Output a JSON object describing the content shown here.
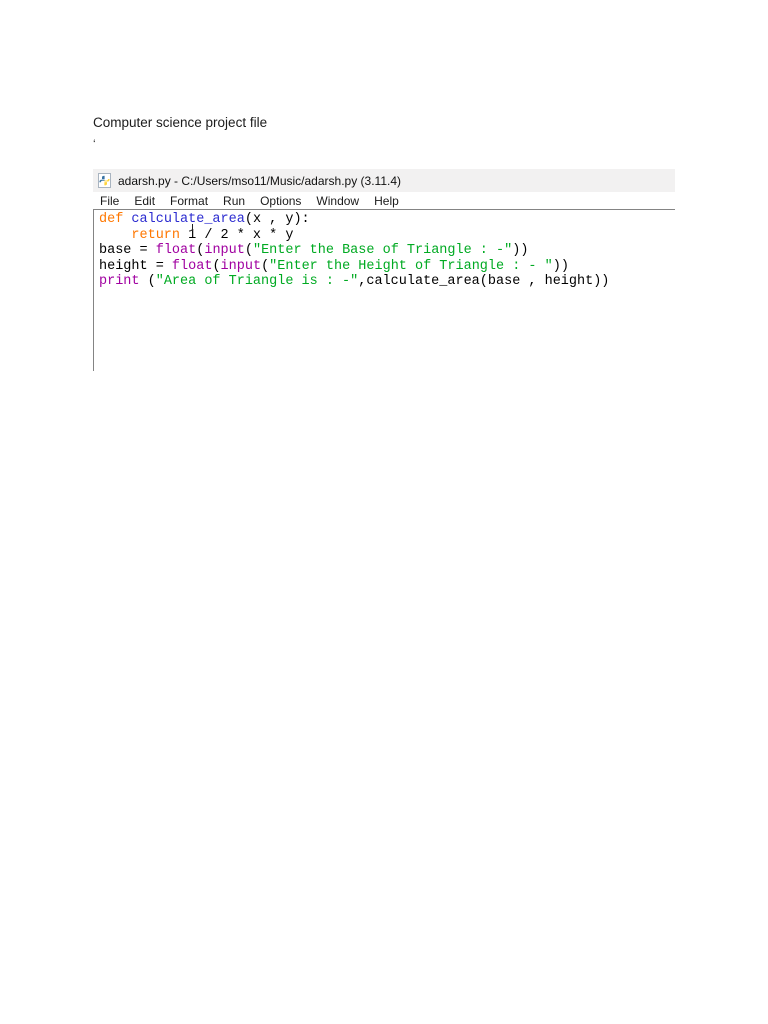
{
  "document": {
    "heading": "Computer science project file",
    "stray_quote": "‘"
  },
  "idle_window": {
    "title": "adarsh.py - C:/Users/mso11/Music/adarsh.py (3.11.4)",
    "icon": "python-file-icon",
    "menu": [
      "File",
      "Edit",
      "Format",
      "Run",
      "Options",
      "Window",
      "Help"
    ],
    "syntax_colors": {
      "keyword": "#ff7700",
      "definition": "#2b2bd0",
      "builtin": "#a000a0",
      "string": "#00aa22",
      "plain": "#000000"
    },
    "code_lines": [
      [
        [
          "def",
          "keyword"
        ],
        [
          " ",
          "plain"
        ],
        [
          "calculate_area",
          "definition"
        ],
        [
          "(x , y):",
          "plain"
        ]
      ],
      [
        [
          "    ",
          "plain"
        ],
        [
          "return",
          "keyword"
        ],
        [
          " 1 / 2 * x * y",
          "plain"
        ]
      ],
      [
        [
          "base = ",
          "plain"
        ],
        [
          "float",
          "builtin"
        ],
        [
          "(",
          "plain"
        ],
        [
          "input",
          "builtin"
        ],
        [
          "(",
          "plain"
        ],
        [
          "\"Enter the Base of Triangle : -\"",
          "string"
        ],
        [
          "))",
          "plain"
        ]
      ],
      [
        [
          "height = ",
          "plain"
        ],
        [
          "float",
          "builtin"
        ],
        [
          "(",
          "plain"
        ],
        [
          "input",
          "builtin"
        ],
        [
          "(",
          "plain"
        ],
        [
          "\"Enter the Height of Triangle : - \"",
          "string"
        ],
        [
          "))",
          "plain"
        ]
      ],
      [
        [
          "print",
          "builtin"
        ],
        [
          " (",
          "plain"
        ],
        [
          "\"Area of Triangle is : -\"",
          "string"
        ],
        [
          ",calculate_area(base , height))",
          "plain"
        ]
      ]
    ]
  }
}
